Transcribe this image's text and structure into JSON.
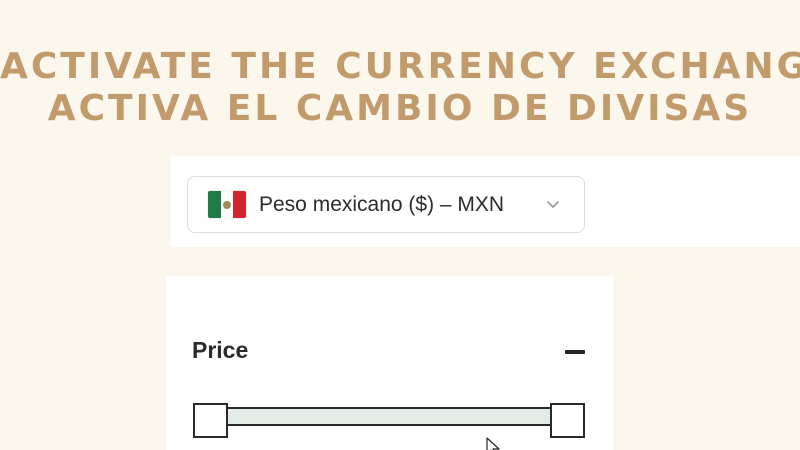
{
  "headline": {
    "line_en": "ACTIVATE THE CURRENCY EXCHANGE",
    "line_es": "ACTIVA EL CAMBIO DE DIVISAS",
    "color": "#c19b6c"
  },
  "currency_selector": {
    "flag_icon": "mexico-flag-icon",
    "selected": "Peso mexicano ($) – MXN",
    "dropdown_icon": "chevron-down-icon"
  },
  "price_filter": {
    "title": "Price",
    "toggle_icon": "minus-icon"
  },
  "colors": {
    "background": "#fbf7ec",
    "track": "#e3ebe6",
    "flag_green": "#1f7a46",
    "flag_red": "#d1262f"
  }
}
